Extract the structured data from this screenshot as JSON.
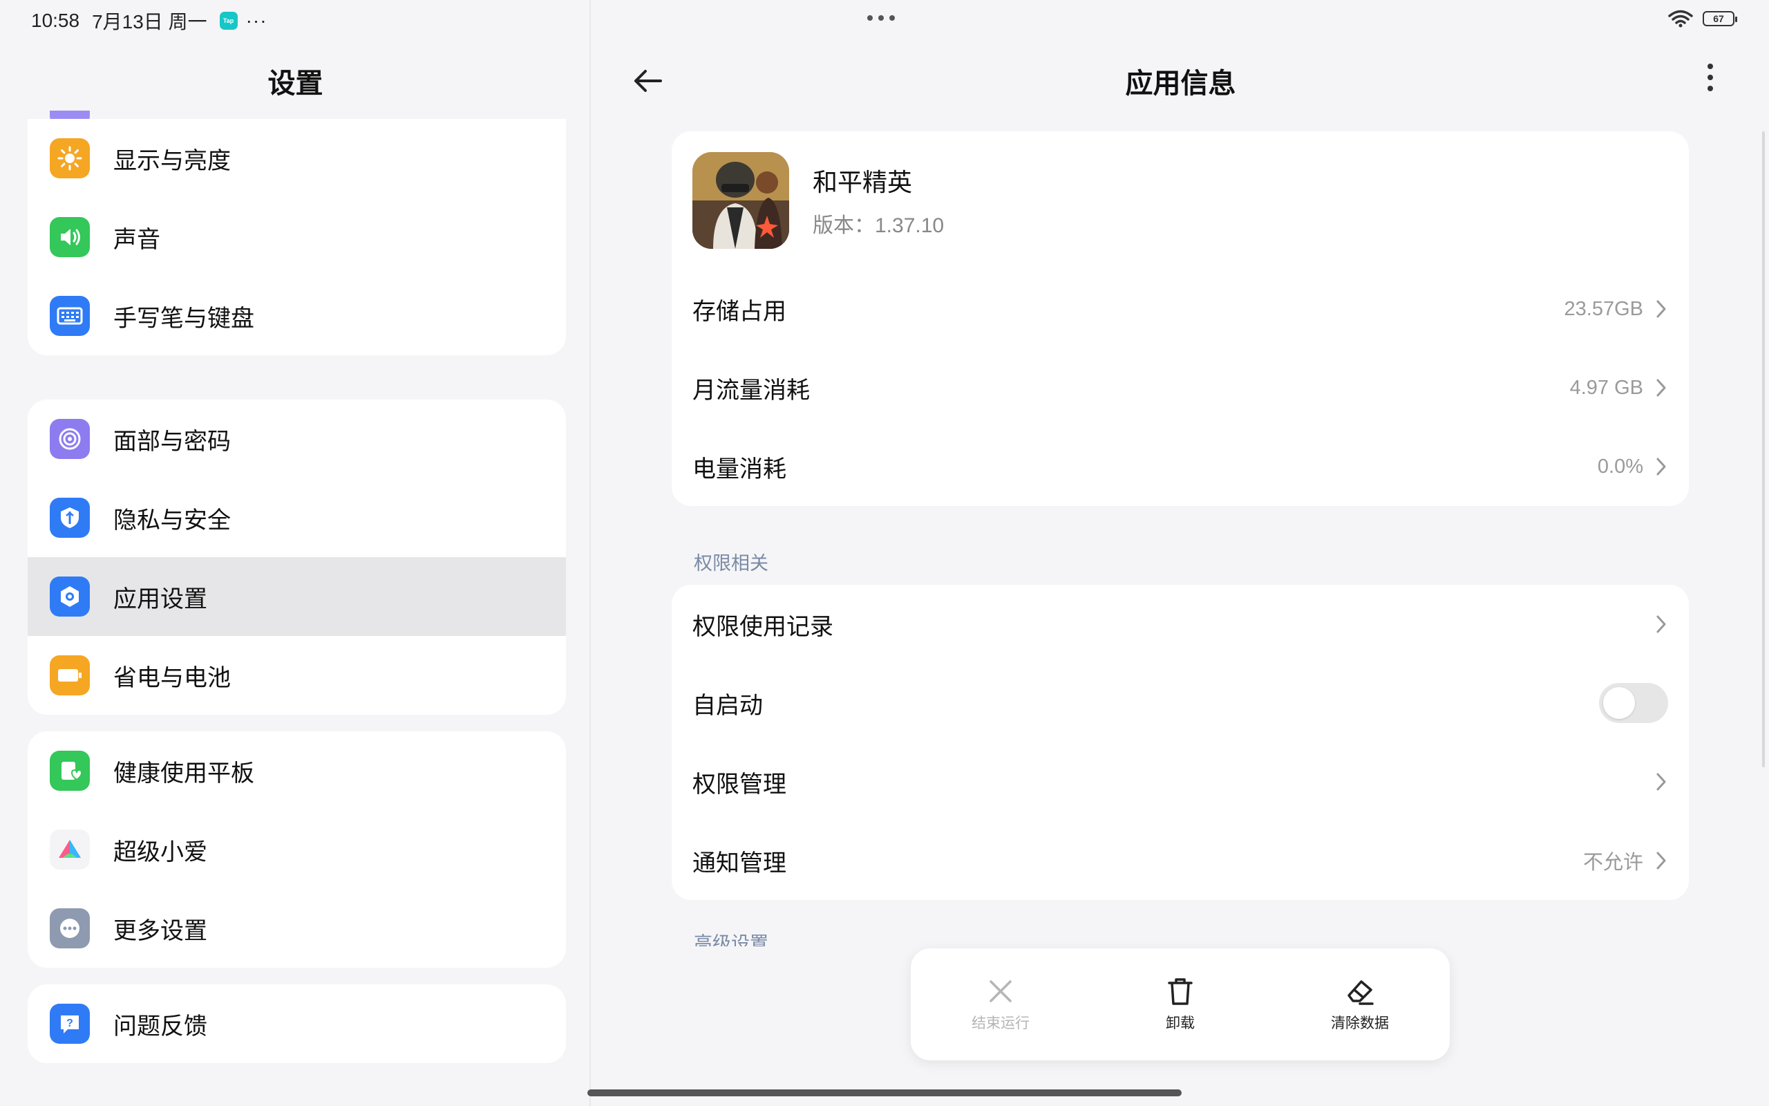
{
  "status": {
    "time": "10:58",
    "date": "7月13日 周一",
    "badge": "Tap",
    "more": "···",
    "battery": "67"
  },
  "left": {
    "title": "设置",
    "groups": [
      [
        {
          "label": "显示与亮度",
          "icon": "sun-icon",
          "color": "#f5a623"
        },
        {
          "label": "声音",
          "icon": "speaker-icon",
          "color": "#34c759"
        },
        {
          "label": "手写笔与键盘",
          "icon": "keyboard-icon",
          "color": "#2f7bf5"
        }
      ],
      [
        {
          "label": "面部与密码",
          "icon": "face-id-icon",
          "color": "#8c7cf0"
        },
        {
          "label": "隐私与安全",
          "icon": "privacy-shield-icon",
          "color": "#2f7bf5"
        },
        {
          "label": "应用设置",
          "icon": "app-settings-icon",
          "color": "#2f7bf5",
          "active": true
        },
        {
          "label": "省电与电池",
          "icon": "battery-icon",
          "color": "#f5a623"
        }
      ],
      [
        {
          "label": "健康使用平板",
          "icon": "health-icon",
          "color": "#34c759"
        },
        {
          "label": "超级小爱",
          "icon": "xiaoai-icon",
          "color": "#ffffff"
        },
        {
          "label": "更多设置",
          "icon": "more-settings-icon",
          "color": "#8e9aaf"
        }
      ],
      [
        {
          "label": "问题反馈",
          "icon": "feedback-icon",
          "color": "#2f7bf5"
        }
      ]
    ]
  },
  "right": {
    "title": "应用信息",
    "app": {
      "name": "和平精英",
      "version": "版本：1.37.10"
    },
    "usage_rows": [
      {
        "label": "存储占用",
        "value": "23.57GB"
      },
      {
        "label": "月流量消耗",
        "value": "4.97 GB"
      },
      {
        "label": "电量消耗",
        "value": "0.0%"
      }
    ],
    "permissions_header": "权限相关",
    "permission_rows": [
      {
        "label": "权限使用记录",
        "value": ""
      },
      {
        "label": "自启动",
        "toggle": false
      },
      {
        "label": "权限管理",
        "value": ""
      },
      {
        "label": "通知管理",
        "value": "不允许"
      }
    ],
    "advanced_header": "高级设置"
  },
  "actions": [
    {
      "label": "结束运行",
      "icon": "close-x-icon",
      "disabled": true
    },
    {
      "label": "卸载",
      "icon": "trash-icon",
      "disabled": false
    },
    {
      "label": "清除数据",
      "icon": "eraser-icon",
      "disabled": false
    }
  ]
}
